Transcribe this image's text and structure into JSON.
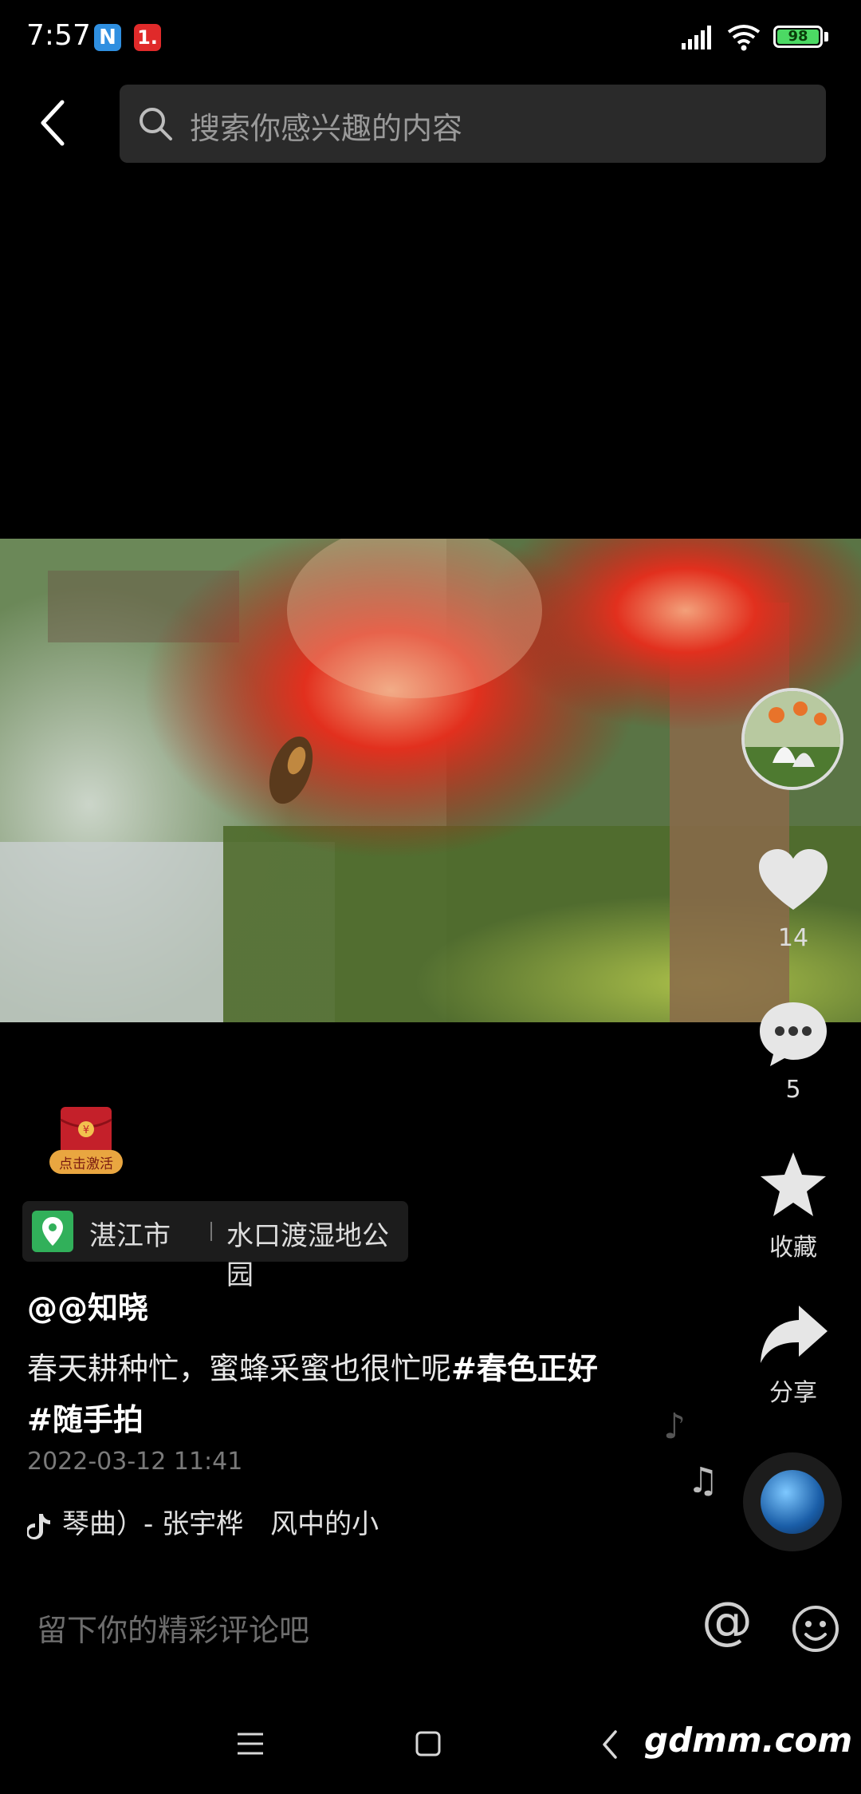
{
  "status_bar": {
    "time": "7:57",
    "notification_icons": [
      "N",
      "1."
    ],
    "battery_level": "98",
    "colors": {
      "battery": "#4cd964",
      "notif_n": "#2f8fe0",
      "notif_1": "#e02a2a"
    }
  },
  "search": {
    "placeholder": "搜索你感兴趣的内容"
  },
  "video": {
    "subject": "red bottlebrush flower with bee"
  },
  "rail": {
    "like_count": "14",
    "comment_count": "5",
    "favorite_label": "收藏",
    "share_label": "分享"
  },
  "red_packet": {
    "label": "点击激活"
  },
  "location": {
    "city": "湛江市",
    "place": "水口渡湿地公园",
    "pin_color": "#31b05a"
  },
  "post": {
    "author": "@@知晓",
    "text_plain": "春天耕种忙，蜜蜂采蜜也很忙呢",
    "tag1": "#春色正好",
    "tag2": "#随手拍",
    "date": "2022-03-12 11:41",
    "music": "琴曲）- 张宇桦　风中的小"
  },
  "comment_bar": {
    "placeholder": "留下你的精彩评论吧",
    "at_symbol": "@"
  },
  "nav": {
    "watermark": "gdmm.com"
  },
  "icons": [
    "back-arrow-icon",
    "search-icon",
    "heart-icon",
    "comment-icon",
    "star-icon",
    "share-icon",
    "music-note-icon",
    "location-pin-icon",
    "tiktok-icon",
    "at-icon",
    "emoji-icon",
    "menu-icon",
    "home-icon",
    "nav-back-icon"
  ]
}
